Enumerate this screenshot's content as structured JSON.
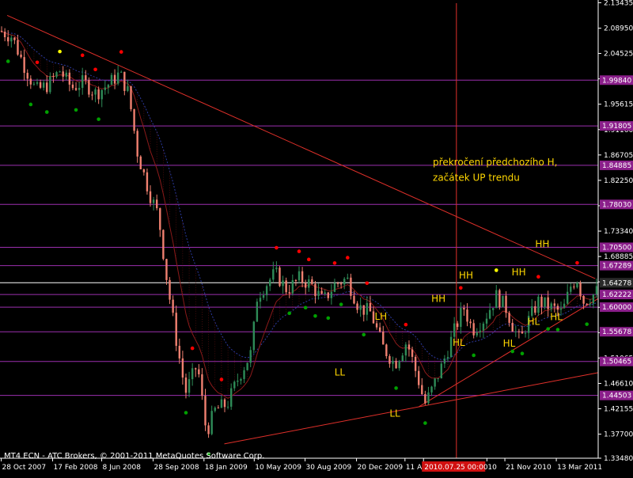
{
  "colors": {
    "background": "#000000",
    "axis": "#ffffff",
    "bull": "#2e8b57",
    "bear": "#f08070",
    "hline": "#9b2fae",
    "hline_label_bg": "#8b1f8b",
    "trend": "#e0302a",
    "vline": "#e0302a",
    "annotation": "#ffd700",
    "ema_blue": "#2c3aa0",
    "ema_red": "#8b1a1a",
    "dot_red": "#ff0000",
    "dot_yellow": "#ffff00",
    "dot_green": "#00a000",
    "highlight_bg": "#d01010"
  },
  "watermark": "MT4 ECN - ATC Brokers, © 2001-2011 MetaQuotes Software Corp.",
  "chart_data": {
    "type": "candlestick",
    "ylim": [
      1.3348,
      2.1335
    ],
    "y_ticks": [
      "2.13435",
      "2.08950",
      "2.04525",
      "2.00070",
      "1.95615",
      "1.91160",
      "1.86705",
      "1.82250",
      "1.77795",
      "1.73340",
      "1.68885",
      "1.64430",
      "1.59975",
      "1.55520",
      "1.51065",
      "1.46610",
      "1.42155",
      "1.37700",
      "1.33480"
    ],
    "x_labels": [
      "28 Oct 2007",
      "17 Feb 2008",
      "8 Jun 2008",
      "28 Sep 2008",
      "18 Jan 2009",
      "10 May 2009",
      "30 Aug 2009",
      "20 Dec 2009",
      "11 A",
      "2010.07.25 00:00",
      "10",
      "21 Nov 2010",
      "13 Mar 2011"
    ],
    "x_label_highlight": "2010.07.25 00:00",
    "levels": [
      {
        "value": 1.9984,
        "label": "1.99840"
      },
      {
        "value": 1.91805,
        "label": "1.91805"
      },
      {
        "value": 1.84885,
        "label": "1.84885"
      },
      {
        "value": 1.7803,
        "label": "1.78030"
      },
      {
        "value": 1.705,
        "label": "1.70500"
      },
      {
        "value": 1.67289,
        "label": "1.67289"
      },
      {
        "value": 1.64278,
        "label": "1.64278",
        "color": "#ffffff"
      },
      {
        "value": 1.62222,
        "label": "1.62222"
      },
      {
        "value": 1.6,
        "label": "1.60000"
      },
      {
        "value": 1.55678,
        "label": "1.55678"
      },
      {
        "value": 1.50465,
        "label": "1.50465"
      },
      {
        "value": 1.44503,
        "label": "1.44503"
      }
    ],
    "annotations": [
      {
        "text": "překročení předchozího H,",
        "x": 0.7236,
        "y": 1.849
      },
      {
        "text": "začátek UP trendu",
        "x": 0.7236,
        "y": 1.822
      },
      {
        "text": "HH",
        "x": 0.721,
        "y": 1.609
      },
      {
        "text": "HH",
        "x": 0.7671,
        "y": 1.65
      },
      {
        "text": "HH",
        "x": 0.8553,
        "y": 1.656
      },
      {
        "text": "HH",
        "x": 0.8947,
        "y": 1.705
      },
      {
        "text": "LH",
        "x": 0.6263,
        "y": 1.578
      },
      {
        "text": "HL",
        "x": 0.7566,
        "y": 1.532
      },
      {
        "text": "HL",
        "x": 0.8408,
        "y": 1.531
      },
      {
        "text": "HL",
        "x": 0.8816,
        "y": 1.569
      },
      {
        "text": "HL",
        "x": 0.9197,
        "y": 1.577
      },
      {
        "text": "LL",
        "x": 0.5592,
        "y": 1.48
      },
      {
        "text": "LL",
        "x": 0.6513,
        "y": 1.408
      }
    ]
  }
}
